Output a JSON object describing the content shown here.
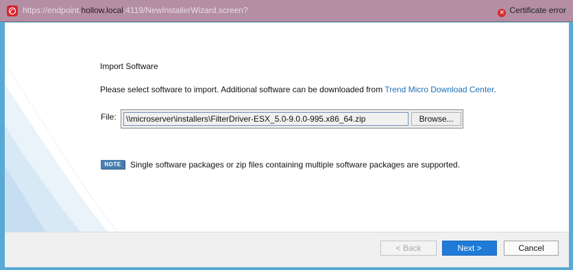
{
  "address_bar": {
    "url_prefix": "https://endpoint.",
    "url_host": "hollow.local",
    "url_suffix": ":4119/NewInstallerWizard.screen?",
    "cert_error": "Certificate error",
    "site_icon": "trend-micro-logo-icon",
    "cert_icon": "error-circle-icon"
  },
  "wizard": {
    "heading": "Import Software",
    "description": "Please select software to import. Additional software can be downloaded from ",
    "download_link": "Trend Micro Download Center",
    "description_end": ".",
    "file_label": "File:",
    "file_value": "\\\\microserver\\installers\\FilterDriver-ESX_5.0-9.0.0-995.x86_64.zip",
    "browse_label": "Browse...",
    "note_badge": "NOTE",
    "note_text": "Single software packages or zip files containing multiple software packages are supported."
  },
  "footer": {
    "back_label": "< Back",
    "next_label": "Next >",
    "cancel_label": "Cancel"
  },
  "colors": {
    "address_bar": "#b48fa3",
    "link": "#1d6fb5",
    "primary_button": "#1f7ad8",
    "note_badge": "#4a7fad",
    "frame": "#59a9d6"
  }
}
